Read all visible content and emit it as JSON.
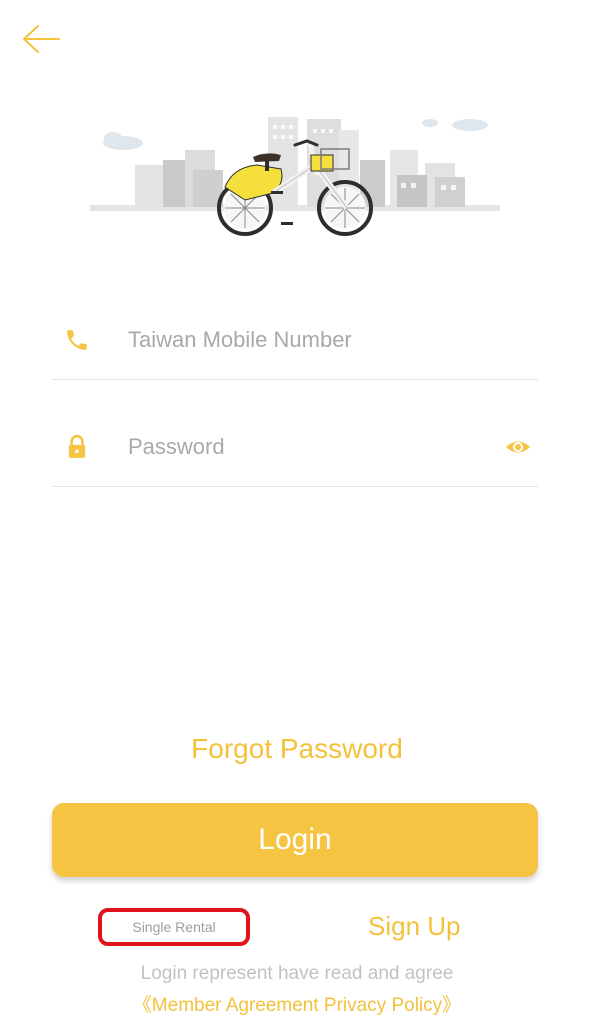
{
  "colors": {
    "accent": "#f5c443",
    "accent_text": "#f4c13b",
    "placeholder": "#a9a9a9",
    "highlight_box": "#e0121b"
  },
  "nav": {
    "back_icon": "back-arrow-icon"
  },
  "hero": {
    "image": "city-bike-illustration"
  },
  "form": {
    "phone": {
      "icon": "phone-icon",
      "placeholder": "Taiwan Mobile Number",
      "value": ""
    },
    "password": {
      "icon": "lock-icon",
      "placeholder": "Password",
      "value": "",
      "toggle_icon": "eye-icon"
    }
  },
  "forgot_label": "Forgot Password",
  "login_label": "Login",
  "single_rental_label": "Single Rental",
  "signup_label": "Sign Up",
  "agreement_text": "Login represent have read and agree",
  "policy_text": "《Member Agreement Privacy Policy》"
}
